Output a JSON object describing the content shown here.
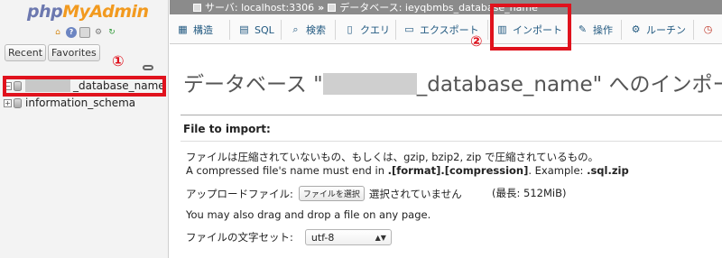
{
  "sidebar": {
    "logo_php": "php",
    "logo_myadmin": "MyAdmin",
    "tabs": [
      "Recent",
      "Favorites"
    ],
    "annotation_1": "①",
    "databases": [
      {
        "name": "_database_name",
        "expander": "−"
      },
      {
        "name": "information_schema",
        "expander": "+"
      }
    ]
  },
  "breadcrumb": {
    "server_label": "サーバ: localhost:3306",
    "separator": "»",
    "db_label": "データベース: ieyqbmbs_database_name"
  },
  "tabs": [
    {
      "id": "structure",
      "label": "構造",
      "icon": "structure-icon"
    },
    {
      "id": "sql",
      "label": "SQL",
      "icon": "sql-icon"
    },
    {
      "id": "search",
      "label": "検索",
      "icon": "search-icon"
    },
    {
      "id": "query",
      "label": "クエリ",
      "icon": "query-icon"
    },
    {
      "id": "export",
      "label": "エクスポート",
      "icon": "export-icon"
    },
    {
      "id": "import",
      "label": "インポート",
      "icon": "import-icon"
    },
    {
      "id": "operations",
      "label": "操作",
      "icon": "wrench-icon"
    },
    {
      "id": "routines",
      "label": "ルーチン",
      "icon": "routines-icon"
    },
    {
      "id": "events",
      "label": "",
      "icon": "clock-icon"
    }
  ],
  "annotation_2": "②",
  "main": {
    "heading_prefix": "データベース \"",
    "heading_db": "_database_name",
    "heading_suffix": "\" へのインポート",
    "file_to_import": "File to import:",
    "line1": "ファイルは圧縮されていないもの、もしくは、gzip, bzip2, zip で圧縮されているもの。",
    "line2_a": "A compressed file's name must end in ",
    "line2_b": ".[format].[compression]",
    "line2_c": ". Example: ",
    "line2_d": ".sql.zip",
    "upload_label": "アップロードファイル:",
    "file_button": "ファイルを選択",
    "no_file": "選択されていません",
    "max_size": "(最長: 512MiB)",
    "drag_drop": "You may also drag and drop a file on any page.",
    "charset_label": "ファイルの文字セット:",
    "charset_value": "utf-8"
  },
  "colors": {
    "highlight": "#e0121d",
    "link": "#235a81"
  }
}
